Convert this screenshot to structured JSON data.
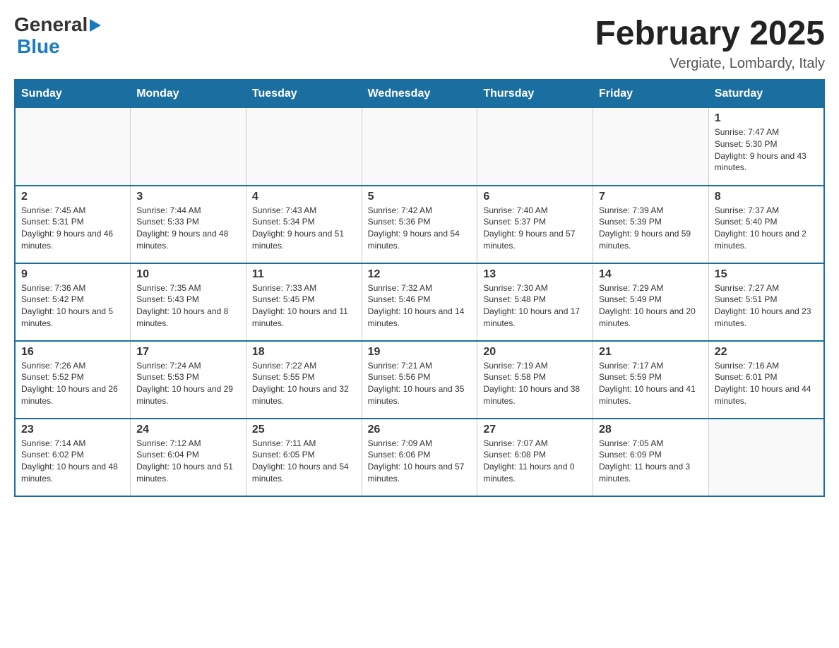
{
  "header": {
    "logo_general": "General",
    "logo_blue": "Blue",
    "title": "February 2025",
    "subtitle": "Vergiate, Lombardy, Italy"
  },
  "days_of_week": [
    "Sunday",
    "Monday",
    "Tuesday",
    "Wednesday",
    "Thursday",
    "Friday",
    "Saturday"
  ],
  "weeks": [
    [
      {
        "day": "",
        "info": ""
      },
      {
        "day": "",
        "info": ""
      },
      {
        "day": "",
        "info": ""
      },
      {
        "day": "",
        "info": ""
      },
      {
        "day": "",
        "info": ""
      },
      {
        "day": "",
        "info": ""
      },
      {
        "day": "1",
        "info": "Sunrise: 7:47 AM\nSunset: 5:30 PM\nDaylight: 9 hours and 43 minutes."
      }
    ],
    [
      {
        "day": "2",
        "info": "Sunrise: 7:45 AM\nSunset: 5:31 PM\nDaylight: 9 hours and 46 minutes."
      },
      {
        "day": "3",
        "info": "Sunrise: 7:44 AM\nSunset: 5:33 PM\nDaylight: 9 hours and 48 minutes."
      },
      {
        "day": "4",
        "info": "Sunrise: 7:43 AM\nSunset: 5:34 PM\nDaylight: 9 hours and 51 minutes."
      },
      {
        "day": "5",
        "info": "Sunrise: 7:42 AM\nSunset: 5:36 PM\nDaylight: 9 hours and 54 minutes."
      },
      {
        "day": "6",
        "info": "Sunrise: 7:40 AM\nSunset: 5:37 PM\nDaylight: 9 hours and 57 minutes."
      },
      {
        "day": "7",
        "info": "Sunrise: 7:39 AM\nSunset: 5:39 PM\nDaylight: 9 hours and 59 minutes."
      },
      {
        "day": "8",
        "info": "Sunrise: 7:37 AM\nSunset: 5:40 PM\nDaylight: 10 hours and 2 minutes."
      }
    ],
    [
      {
        "day": "9",
        "info": "Sunrise: 7:36 AM\nSunset: 5:42 PM\nDaylight: 10 hours and 5 minutes."
      },
      {
        "day": "10",
        "info": "Sunrise: 7:35 AM\nSunset: 5:43 PM\nDaylight: 10 hours and 8 minutes."
      },
      {
        "day": "11",
        "info": "Sunrise: 7:33 AM\nSunset: 5:45 PM\nDaylight: 10 hours and 11 minutes."
      },
      {
        "day": "12",
        "info": "Sunrise: 7:32 AM\nSunset: 5:46 PM\nDaylight: 10 hours and 14 minutes."
      },
      {
        "day": "13",
        "info": "Sunrise: 7:30 AM\nSunset: 5:48 PM\nDaylight: 10 hours and 17 minutes."
      },
      {
        "day": "14",
        "info": "Sunrise: 7:29 AM\nSunset: 5:49 PM\nDaylight: 10 hours and 20 minutes."
      },
      {
        "day": "15",
        "info": "Sunrise: 7:27 AM\nSunset: 5:51 PM\nDaylight: 10 hours and 23 minutes."
      }
    ],
    [
      {
        "day": "16",
        "info": "Sunrise: 7:26 AM\nSunset: 5:52 PM\nDaylight: 10 hours and 26 minutes."
      },
      {
        "day": "17",
        "info": "Sunrise: 7:24 AM\nSunset: 5:53 PM\nDaylight: 10 hours and 29 minutes."
      },
      {
        "day": "18",
        "info": "Sunrise: 7:22 AM\nSunset: 5:55 PM\nDaylight: 10 hours and 32 minutes."
      },
      {
        "day": "19",
        "info": "Sunrise: 7:21 AM\nSunset: 5:56 PM\nDaylight: 10 hours and 35 minutes."
      },
      {
        "day": "20",
        "info": "Sunrise: 7:19 AM\nSunset: 5:58 PM\nDaylight: 10 hours and 38 minutes."
      },
      {
        "day": "21",
        "info": "Sunrise: 7:17 AM\nSunset: 5:59 PM\nDaylight: 10 hours and 41 minutes."
      },
      {
        "day": "22",
        "info": "Sunrise: 7:16 AM\nSunset: 6:01 PM\nDaylight: 10 hours and 44 minutes."
      }
    ],
    [
      {
        "day": "23",
        "info": "Sunrise: 7:14 AM\nSunset: 6:02 PM\nDaylight: 10 hours and 48 minutes."
      },
      {
        "day": "24",
        "info": "Sunrise: 7:12 AM\nSunset: 6:04 PM\nDaylight: 10 hours and 51 minutes."
      },
      {
        "day": "25",
        "info": "Sunrise: 7:11 AM\nSunset: 6:05 PM\nDaylight: 10 hours and 54 minutes."
      },
      {
        "day": "26",
        "info": "Sunrise: 7:09 AM\nSunset: 6:06 PM\nDaylight: 10 hours and 57 minutes."
      },
      {
        "day": "27",
        "info": "Sunrise: 7:07 AM\nSunset: 6:08 PM\nDaylight: 11 hours and 0 minutes."
      },
      {
        "day": "28",
        "info": "Sunrise: 7:05 AM\nSunset: 6:09 PM\nDaylight: 11 hours and 3 minutes."
      },
      {
        "day": "",
        "info": ""
      }
    ]
  ]
}
